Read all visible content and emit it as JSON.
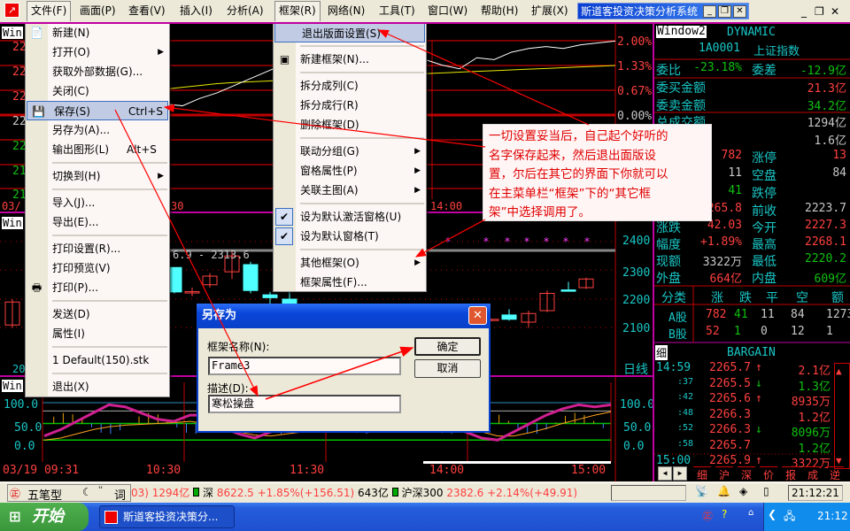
{
  "menubar": {
    "items": [
      "文件(F)",
      "画面(P)",
      "查看(V)",
      "插入(I)",
      "分析(A)",
      "框架(R)",
      "网络(N)",
      "工具(T)",
      "窗口(W)",
      "帮助(H)",
      "扩展(X)"
    ],
    "window_title": "斯道客投资决策分析系统",
    "min": "_",
    "restore": "❐",
    "close": "✕"
  },
  "file_menu": [
    {
      "label": "新建(N)",
      "icon": "📄"
    },
    {
      "label": "打开(O)",
      "submenu": true
    },
    {
      "label": "获取外部数据(G)..."
    },
    {
      "label": "关闭(C)"
    },
    {
      "label": "保存(S)",
      "shortcut": "Ctrl+S",
      "icon": "💾",
      "highlight": true
    },
    {
      "label": "另存为(A)..."
    },
    {
      "label": "输出图形(L)",
      "shortcut": "Alt+S"
    },
    {
      "sep": true
    },
    {
      "label": "切换到(H)",
      "submenu": true
    },
    {
      "sep": true
    },
    {
      "label": "导入(J)..."
    },
    {
      "label": "导出(E)..."
    },
    {
      "sep": true
    },
    {
      "label": "打印设置(R)..."
    },
    {
      "label": "打印预览(V)"
    },
    {
      "label": "打印(P)...",
      "icon": "🖶"
    },
    {
      "sep": true
    },
    {
      "label": "发送(D)"
    },
    {
      "label": "属性(I)"
    },
    {
      "sep": true
    },
    {
      "label": "1 Default(150).stk"
    },
    {
      "sep": true
    },
    {
      "label": "退出(X)"
    }
  ],
  "frame_menu": [
    {
      "label": "退出版面设置(S)",
      "highlight": true
    },
    {
      "sep": true
    },
    {
      "label": "新建框架(N)...",
      "icon": "▣"
    },
    {
      "sep": true
    },
    {
      "label": "拆分成列(C)"
    },
    {
      "label": "拆分成行(R)"
    },
    {
      "label": "删除框架(D)"
    },
    {
      "sep": true
    },
    {
      "label": "联动分组(G)",
      "submenu": true
    },
    {
      "label": "窗格属性(P)",
      "submenu": true
    },
    {
      "label": "关联主图(A)",
      "submenu": true
    },
    {
      "sep": true
    },
    {
      "label": "设为默认激活窗格(U)",
      "checked": true
    },
    {
      "label": "设为默认窗格(T)",
      "checked": true
    },
    {
      "sep": true
    },
    {
      "label": "其他框架(O)",
      "submenu": true
    },
    {
      "label": "框架属性(F)..."
    }
  ],
  "annotation": [
    "一切设置妥当后，自己起个好听的",
    "名字保存起来，然后退出面版设",
    "置，尔后在其它的界面下你就可以",
    "在主菜单栏“框架”下的“其它框",
    "架”中选择调用了。"
  ],
  "dialog": {
    "title": "另存为",
    "name_label": "框架名称(N):",
    "name_value": "Frame3",
    "desc_label": "描述(D):",
    "desc_value": "寒松操盘",
    "ok": "确定",
    "cancel": "取消"
  },
  "chart_top": {
    "window_label": "Win",
    "left_axis": [
      "22",
      "22",
      "22",
      "22",
      "22",
      "21",
      "21"
    ],
    "right_axis": [
      "2.00%",
      "1.33%",
      "0.67%",
      "0.00%"
    ],
    "time_labels": [
      "03/",
      "30",
      "14:00"
    ],
    "price_line": [
      0.2,
      0.1,
      -0.1,
      -0.2,
      0.0,
      0.15,
      0.1,
      0.35,
      0.3,
      0.25,
      0.45,
      0.6,
      0.8,
      1.0,
      1.2,
      1.4,
      1.6,
      1.7,
      1.8,
      1.9,
      1.85,
      1.7,
      1.45,
      1.5,
      1.35,
      1.25,
      1.55,
      1.5,
      1.7,
      1.8,
      1.85,
      1.8,
      1.9,
      1.95,
      2.0
    ],
    "avg_line": [
      0.55,
      0.52,
      0.5,
      0.5,
      0.52,
      0.55,
      0.6,
      0.65,
      0.7,
      0.75,
      0.8,
      0.85,
      0.88,
      0.9,
      0.92,
      0.95,
      0.97,
      1.0,
      1.02,
      1.04,
      1.06,
      1.08,
      1.1,
      1.12,
      1.14,
      1.16,
      1.18,
      1.2,
      1.22,
      1.24,
      1.26,
      1.28,
      1.3,
      1.32,
      1.34
    ]
  },
  "chart_kline": {
    "window_label": "Win",
    "range_text": "6.9 - 2313.6",
    "right_axis": [
      "2400",
      "2300",
      "2200",
      "2100"
    ],
    "period": "日线",
    "date_label": "20",
    "candles": [
      {
        "o": 2110,
        "h": 2200,
        "l": 2100,
        "c": 2190
      },
      {
        "o": 2310,
        "h": 2310,
        "l": 2220,
        "c": 2225
      },
      {
        "o": 2225,
        "h": 2240,
        "l": 2210,
        "c": 2226
      },
      {
        "o": 2250,
        "h": 2290,
        "l": 2240,
        "c": 2280
      },
      {
        "o": 2295,
        "h": 2365,
        "l": 2270,
        "c": 2350
      },
      {
        "o": 2320,
        "h": 2330,
        "l": 2220,
        "c": 2230
      },
      {
        "o": 2215,
        "h": 2225,
        "l": 2180,
        "c": 2205
      },
      {
        "o": 2200,
        "h": 2230,
        "l": 2170,
        "c": 2180
      },
      {
        "o": 2128,
        "h": 2130,
        "l": 2126,
        "c": 2130
      },
      {
        "o": 2145,
        "h": 2165,
        "l": 2125,
        "c": 2130
      },
      {
        "o": 2120,
        "h": 2160,
        "l": 2100,
        "c": 2150
      },
      {
        "o": 2160,
        "h": 2230,
        "l": 2155,
        "c": 2220
      },
      {
        "o": 2232,
        "h": 2260,
        "l": 2228,
        "c": 2230
      },
      {
        "o": 2240,
        "h": 2275,
        "l": 2235,
        "c": 2270
      }
    ],
    "markers": 7
  },
  "chart_ind": {
    "window_label": "Win",
    "axis": [
      "100.0",
      "50.0",
      "0.0"
    ],
    "time_labels": [
      "03/19 09:31",
      "10:30",
      "11:30",
      "14:00",
      "15:00"
    ],
    "k_line": [
      20,
      35,
      55,
      75,
      95,
      90,
      75,
      60,
      55,
      70,
      70,
      40,
      25,
      15,
      30,
      55,
      75,
      70,
      60,
      45,
      30,
      50,
      70,
      85,
      95,
      60,
      30,
      15,
      10,
      30,
      50,
      70,
      85,
      95,
      90,
      95
    ],
    "d_line": [
      10,
      15,
      25,
      35,
      42,
      46,
      48,
      50,
      52,
      55,
      50,
      40,
      30,
      22,
      20,
      25,
      30,
      40,
      50,
      55,
      50,
      45,
      48,
      55,
      65,
      60,
      45,
      30,
      20,
      20,
      28,
      38,
      50,
      60,
      70,
      78
    ]
  },
  "right_panel": {
    "window_label": "Window2",
    "mode": "DYNAMIC",
    "code": "1A0001",
    "name": "上证指数",
    "rows": [
      {
        "l1": "委比",
        "v1": "-23.18%",
        "c1": "gr",
        "l2": "委差",
        "v2": "-12.9亿",
        "c2": "gr"
      },
      {
        "l1": "委买金额",
        "v2": "21.3亿",
        "c2": "rd"
      },
      {
        "l1": "委卖金额",
        "v2": "34.2亿",
        "c2": "gr"
      },
      {
        "l1": "总成交额",
        "v2": "1294亿",
        "c2": "wh"
      },
      {
        "v2": "1.6亿",
        "c2": "wh"
      },
      {
        "v1": "782",
        "c1": "rd",
        "l2": "涨停",
        "v2": "13",
        "c2": "rd"
      },
      {
        "v1": "11",
        "c1": "wh",
        "l2": "空盘",
        "v2": "84",
        "c2": "wh"
      },
      {
        "v1": "41",
        "c1": "gr",
        "l2": "跌停"
      },
      {
        "v1": "2265.8",
        "c1": "rd",
        "l2": "前收",
        "v2": "2223.7",
        "c2": "wh"
      },
      {
        "l1": "涨跌",
        "v1": "42.03",
        "c1": "rd",
        "l2": "今开",
        "v2": "2227.3",
        "c2": "rd"
      },
      {
        "l1": "幅度",
        "v1": "+1.89%",
        "c1": "rd",
        "l2": "最高",
        "v2": "2268.1",
        "c2": "rd"
      },
      {
        "l1": "现额",
        "v1": "3322万",
        "c1": "wh",
        "l2": "最低",
        "v2": "2220.2",
        "c2": "gr"
      },
      {
        "l1": "外盘",
        "v1": "664亿",
        "c1": "rd",
        "l2": "内盘",
        "v2": "609亿",
        "c2": "gr"
      }
    ],
    "cat_headers": [
      "分类",
      "涨",
      "跌",
      "平",
      "空",
      "额"
    ],
    "cat_rows": [
      [
        "A股",
        "782",
        "41",
        "11",
        "84",
        "1273"
      ],
      [
        "B股",
        "52",
        "1",
        "0",
        "12",
        "1"
      ]
    ],
    "ticks_tab": "细",
    "ticks_title": "BARGAIN",
    "ticks": [
      {
        "t": "14:59",
        "p": "2265.7",
        "d": "↑",
        "v": "2.1亿",
        "vc": "rd"
      },
      {
        "t": ":37",
        "p": "2265.5",
        "d": "↓",
        "v": "1.3亿",
        "vc": "gr"
      },
      {
        "t": ":42",
        "p": "2265.6",
        "d": "↑",
        "v": "8935万",
        "vc": "rd"
      },
      {
        "t": ":48",
        "p": "2266.3",
        "d": "",
        "v": "1.2亿",
        "vc": "rd"
      },
      {
        "t": ":52",
        "p": "2266.3",
        "d": "↓",
        "v": "8096万",
        "vc": "gr"
      },
      {
        "t": ":58",
        "p": "2265.7",
        "d": "",
        "v": "1.2亿",
        "vc": "gr"
      },
      {
        "t": "15:00",
        "p": "2265.9",
        "d": "↑",
        "v": "3322万",
        "vc": "rd"
      }
    ],
    "bottom_tabs": [
      "细",
      "沪",
      "深",
      "价",
      "报",
      "成",
      "逆"
    ]
  },
  "status": {
    "ime": [
      "五笔型",
      "词"
    ],
    "seg1": "03) 1294亿",
    "sz_label": "深",
    "sz_quote": "8622.5 +1.85%(+156.51)",
    "sz_amount": "643亿",
    "hs_label": "沪深300",
    "hs_quote": "2382.6 +2.14%(+49.91)",
    "clock": "21:12:21"
  },
  "taskbar": {
    "start": "开始",
    "task": "斯道客投资决策分...",
    "time": "21:12"
  },
  "colors": {
    "up": "#ff4040",
    "down": "#10c010",
    "label": "#19c6c6",
    "grid": "#c00000",
    "border": "#c000a0"
  }
}
